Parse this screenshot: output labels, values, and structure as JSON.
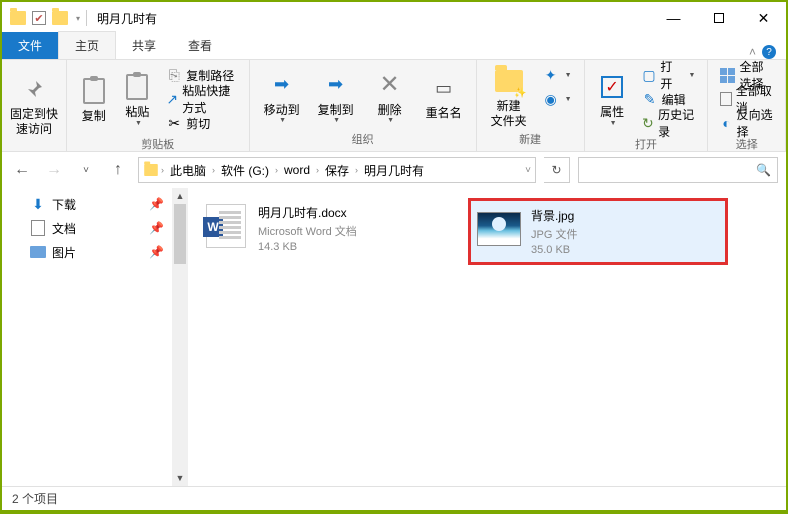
{
  "window": {
    "title": "明月几时有",
    "controls": {
      "min": "—",
      "max": "",
      "close": "✕"
    }
  },
  "tabs": {
    "file": "文件",
    "home": "主页",
    "share": "共享",
    "view": "查看"
  },
  "ribbon": {
    "group_clipboard": "剪贴板",
    "group_organize": "组织",
    "group_new": "新建",
    "group_open": "打开",
    "group_select": "选择",
    "pin_quick": "固定到快\n速访问",
    "copy": "复制",
    "paste": "粘贴",
    "copy_path": "复制路径",
    "paste_shortcut": "粘贴快捷方式",
    "cut": "剪切",
    "move_to": "移动到",
    "copy_to": "复制到",
    "delete": "删除",
    "rename": "重名名",
    "new_folder": "新建\n文件夹",
    "properties": "属性",
    "open": "打开",
    "edit": "编辑",
    "history": "历史记录",
    "select_all": "全部选择",
    "select_none": "全部取消",
    "invert": "反向选择"
  },
  "address": {
    "segments": [
      "此电脑",
      "软件 (G:)",
      "word",
      "保存",
      "明月几时有"
    ],
    "search_placeholder": ""
  },
  "sidebar": {
    "items": [
      {
        "label": "下载"
      },
      {
        "label": "文档"
      },
      {
        "label": "图片"
      }
    ]
  },
  "files": [
    {
      "name": "明月几时有.docx",
      "type": "Microsoft Word 文档",
      "size": "14.3 KB",
      "kind": "word"
    },
    {
      "name": "背景.jpg",
      "type": "JPG 文件",
      "size": "35.0 KB",
      "kind": "image",
      "selected": true
    }
  ],
  "status": {
    "item_count": "2 个项目"
  }
}
